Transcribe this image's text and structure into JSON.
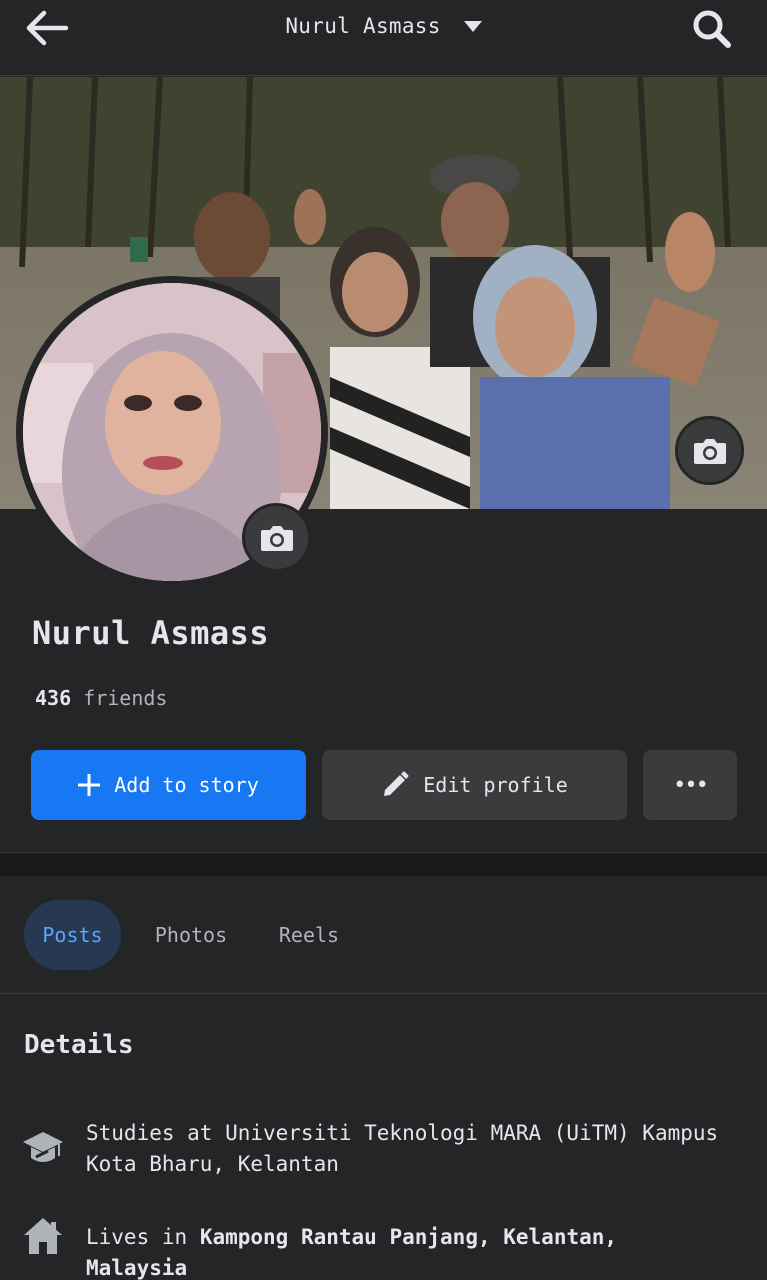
{
  "header": {
    "title": "Nurul Asmass",
    "back_icon": "arrow-left-icon",
    "search_icon": "search-icon"
  },
  "cover": {
    "camera_icon": "camera-icon"
  },
  "avatar": {
    "camera_icon": "camera-icon"
  },
  "profile": {
    "name": "Nurul Asmass",
    "friends_count": "436",
    "friends_label": "friends"
  },
  "actions": {
    "add_story": "Add to story",
    "edit_profile": "Edit profile",
    "more": "•••"
  },
  "tabs": [
    {
      "label": "Posts",
      "active": true
    },
    {
      "label": "Photos",
      "active": false
    },
    {
      "label": "Reels",
      "active": false
    }
  ],
  "details": {
    "title": "Details",
    "studies": {
      "text": "Studies at Universiti Teknologi MARA (UiTM) Kampus Kota Bharu, Kelantan",
      "icon": "graduation-cap-icon"
    },
    "lives": {
      "prefix": "Lives in",
      "place": "Kampong Rantau Panjang, Kelantan, Malaysia",
      "icon": "house-icon"
    }
  },
  "colors": {
    "accent": "#1877f2",
    "background": "#242527",
    "active_tab_bg": "#263951",
    "active_tab_text": "#5aa7ff"
  }
}
